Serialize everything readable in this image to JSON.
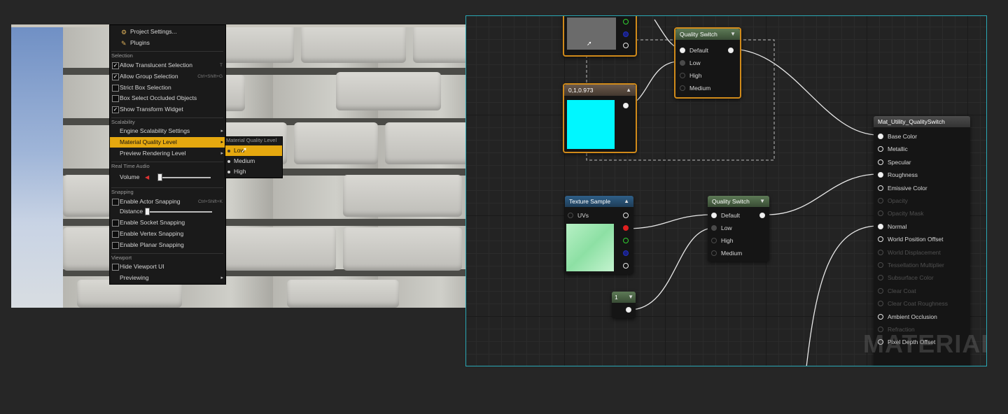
{
  "menu": {
    "items_top": [
      {
        "label": "Project Settings...",
        "icon": "gear-icon"
      },
      {
        "label": "Plugins",
        "icon": "plug-icon"
      }
    ],
    "selection_header": "Selection",
    "selection_items": [
      {
        "label": "Allow Translucent Selection",
        "shortcut": "T",
        "checked": true
      },
      {
        "label": "Allow Group Selection",
        "shortcut": "Ctrl+Shift+G",
        "checked": true
      },
      {
        "label": "Strict Box Selection",
        "shortcut": "",
        "checked": false
      },
      {
        "label": "Box Select Occluded Objects",
        "shortcut": "",
        "checked": false
      },
      {
        "label": "Show Transform Widget",
        "shortcut": "",
        "checked": true
      }
    ],
    "scalability_header": "Scalability",
    "scalability_items": [
      {
        "label": "Engine Scalability Settings"
      },
      {
        "label": "Material Quality Level"
      },
      {
        "label": "Preview Rendering Level"
      }
    ],
    "audio_header": "Real Time Audio",
    "volume_label": "Volume",
    "snapping_header": "Snapping",
    "actor_snapping": {
      "label": "Enable Actor Snapping",
      "shortcut": "Ctrl+Shift+K",
      "checked": false
    },
    "distance_label": "Distance",
    "snapping_items": [
      {
        "label": "Enable Socket Snapping",
        "checked": false
      },
      {
        "label": "Enable Vertex Snapping",
        "checked": false
      },
      {
        "label": "Enable Planar Snapping",
        "checked": false
      }
    ],
    "viewport_header": "Viewport",
    "hide_viewport_ui": {
      "label": "Hide Viewport UI",
      "checked": false
    },
    "previewing_label": "Previewing"
  },
  "submenu": {
    "header": "Material Quality Level",
    "options": [
      "Low",
      "Medium",
      "High"
    ],
    "selected": "Low"
  },
  "graph": {
    "quality_switch_top": {
      "title": "Quality Switch",
      "pins": [
        "Default",
        "Low",
        "High",
        "Medium"
      ]
    },
    "constant_node": {
      "title": "0,1,0.973",
      "color": "#00f7ff"
    },
    "texture_sample": {
      "title": "Texture Sample",
      "input": "UVs"
    },
    "quality_switch_bottom": {
      "title": "Quality Switch",
      "pins": [
        "Default",
        "Low",
        "High",
        "Medium"
      ]
    },
    "scalar_node": {
      "title": "1"
    },
    "result_node": {
      "title": "Mat_Utility_QualitySwitch",
      "pins": [
        {
          "label": "Base Color",
          "active": true,
          "connected": true
        },
        {
          "label": "Metallic",
          "active": true,
          "connected": false
        },
        {
          "label": "Specular",
          "active": true,
          "connected": false
        },
        {
          "label": "Roughness",
          "active": true,
          "connected": true
        },
        {
          "label": "Emissive Color",
          "active": true,
          "connected": false
        },
        {
          "label": "Opacity",
          "active": false,
          "connected": false
        },
        {
          "label": "Opacity Mask",
          "active": false,
          "connected": false
        },
        {
          "label": "Normal",
          "active": true,
          "connected": true
        },
        {
          "label": "World Position Offset",
          "active": true,
          "connected": false
        },
        {
          "label": "World Displacement",
          "active": false,
          "connected": false
        },
        {
          "label": "Tessellation Multiplier",
          "active": false,
          "connected": false
        },
        {
          "label": "Subsurface Color",
          "active": false,
          "connected": false
        },
        {
          "label": "Clear Coat",
          "active": false,
          "connected": false
        },
        {
          "label": "Clear Coat Roughness",
          "active": false,
          "connected": false
        },
        {
          "label": "Ambient Occlusion",
          "active": true,
          "connected": false
        },
        {
          "label": "Refraction",
          "active": false,
          "connected": false
        },
        {
          "label": "Pixel Depth Offset",
          "active": true,
          "connected": false
        }
      ]
    },
    "watermark": "MATERIAL"
  },
  "colors": {
    "accent": "#e5a80f",
    "frame": "#2aa8b5",
    "selected_node": "#d08a1a"
  }
}
